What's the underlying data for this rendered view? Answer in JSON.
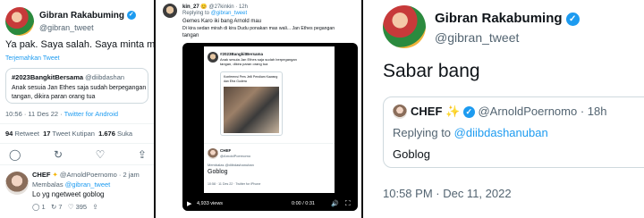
{
  "panel1": {
    "name": "Gibran Rakabuming",
    "handle": "@gibran_tweet",
    "text": "Ya pak. Saya salah. Saya minta maaf",
    "translate": "Terjemahkan Tweet",
    "quote_tag": "#2023BangkitBersama",
    "quote_handle": "@diibdashan",
    "quote_text_1": "Anak sesuia Jan Ethes saja sudah berpegangan",
    "quote_text_2": "tangan, dikira paran orang tua",
    "meta_time": "10:56 · 11 Des 22",
    "meta_source": "Twitter for Android",
    "retweets_count": "94",
    "retweets_label": "Retweet",
    "quotes_count": "17",
    "quotes_label": "Tweet Kutipan",
    "likes_count": "1.676",
    "likes_label": "Suka",
    "reply_name": "CHEF",
    "reply_handle": "@ArnoldPoernomo · 2 jam",
    "reply_to_prefix": "Membalas",
    "reply_to_handle": "@gibran_tweet",
    "reply_text": "Lo yg ngetweet goblog",
    "reply_count": "1",
    "reply_retweets": "7",
    "reply_likes": "395"
  },
  "panel2": {
    "name": "kin_27",
    "handle": "@27kinkin · 12h",
    "replying_prefix": "Replying to",
    "replying_handle": "@gibran_tweet",
    "text_1": "Gemes Karo iki bang Arnold mau",
    "text_2": "Di kira sedan mirah di kira Dudu ponakan mas wali... Jan Ethes pegangan",
    "text_3": "tangan",
    "video_views": "4,933 views",
    "video_time": "0:00 / 0:31",
    "inner_tweet_tag": "#2023BangkitBersama",
    "inner_tweet_text": "Anak sesuia Jan Ethes saja sudah berpegangan tangan, dikira paran orang tua",
    "inner_quote_text": "Konferensi Pers Jelli Pendiam Kawang dan Efra Gudera",
    "chef_name": "CHEF",
    "chef_handle": "@ArnoldPoernomo",
    "chef_reply": "Membalas @diibdashanuban",
    "chef_text": "Goblog",
    "chef_meta": "10:58 · 11 Des 22 · Twitter for iPhone"
  },
  "panel3": {
    "name": "Gibran Rakabuming",
    "handle": "@gibran_tweet",
    "text": "Sabar bang",
    "quote_name": "CHEF",
    "quote_sparkle": "✨",
    "quote_handle": "@ArnoldPoernomo · 18h",
    "quote_replying_prefix": "Replying to",
    "quote_replying_handle": "@diibdashanuban",
    "quote_text": "Goblog",
    "timestamp": "10:58 PM · Dec 11, 2022"
  }
}
